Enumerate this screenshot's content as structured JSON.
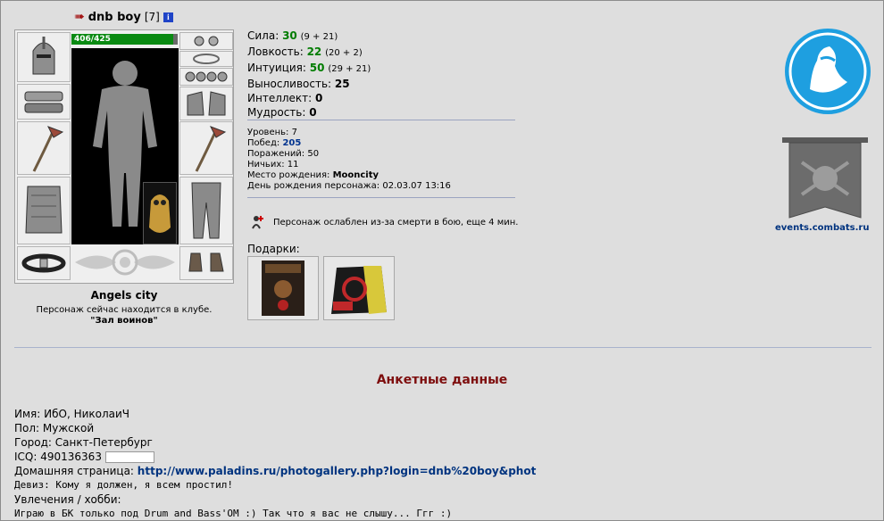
{
  "header": {
    "nick": "dnb boy",
    "level": "[7]",
    "info_icon": "i"
  },
  "hp": {
    "text": "406/425",
    "current": 406,
    "max": 425
  },
  "location": {
    "city": "Angels city",
    "status": "Персонаж сейчас находится в клубе.",
    "room": "\"Зал воинов\""
  },
  "stats": [
    {
      "label": "Сила:",
      "value": "30",
      "detail": "(9 + 21)",
      "boosted": true
    },
    {
      "label": "Ловкость:",
      "value": "22",
      "detail": "(20 + 2)",
      "boosted": true
    },
    {
      "label": "Интуиция:",
      "value": "50",
      "detail": "(29 + 21)",
      "boosted": true
    },
    {
      "label": "Выносливость:",
      "value": "25",
      "detail": "",
      "boosted": false
    },
    {
      "label": "Интеллект:",
      "value": "0",
      "detail": "",
      "boosted": false
    },
    {
      "label": "Мудрость:",
      "value": "0",
      "detail": "",
      "boosted": false
    }
  ],
  "info": {
    "level": {
      "label": "Уровень:",
      "value": "7"
    },
    "wins": {
      "label": "Побед:",
      "value": "205"
    },
    "losses": {
      "label": "Поражений:",
      "value": "50"
    },
    "draws": {
      "label": "Ничьих:",
      "value": "11"
    },
    "birthplace": {
      "label": "Место рождения:",
      "value": "Mooncity"
    },
    "birthday": {
      "label": "День рождения персонажа:",
      "value": "02.03.07 13:16"
    }
  },
  "weakness": "Персонаж ослаблен из-за смерти в бою, еще 4 мин.",
  "gifts_label": "Подарки:",
  "events_link": "events.combats.ru",
  "flag_text": "events",
  "anketa_title": "Анкетные данные",
  "profile": {
    "name": {
      "label": "Имя:",
      "value": "ИбО, НиколаиЧ"
    },
    "gender": {
      "label": "Пол:",
      "value": "Мужской"
    },
    "city": {
      "label": "Город:",
      "value": "Санкт-Петербург"
    },
    "icq": {
      "label": "ICQ:",
      "value": "490136363"
    },
    "homepage": {
      "label": "Домашняя страница:",
      "value": "http://www.paladins.ru/photogallery.php?login=dnb%20boy&phot"
    },
    "motto": {
      "label": "Девиз:",
      "value": "Кому я должен, я всем простил!"
    },
    "hobby": {
      "label": "Увлечения / хобби:",
      "value": ""
    },
    "about": "Играю в БК только под Drum and Bass'OM :) Так что я вас не слышу... Ггг :)"
  },
  "colors": {
    "background": "#dedede",
    "boosted_stat": "#007c00",
    "link": "#00337f",
    "title": "#7e0e0e",
    "hp": "#0a8a12"
  }
}
